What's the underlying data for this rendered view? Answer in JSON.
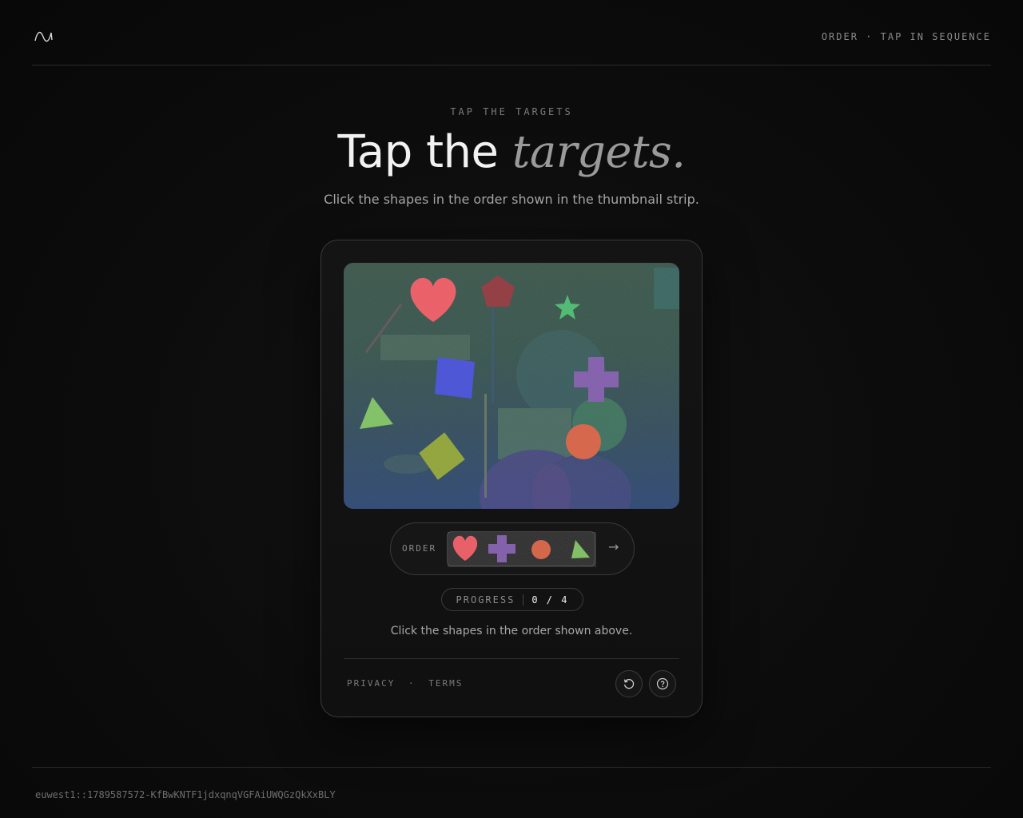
{
  "header": {
    "logo_icon": "wave-logo-icon",
    "nav_text": "ORDER · TAP IN SEQUENCE"
  },
  "hero": {
    "eyebrow": "TAP THE TARGETS",
    "title_plain": "Tap the",
    "title_italic": "targets.",
    "subtitle": "Click the shapes in the order shown in the thumbnail strip."
  },
  "challenge": {
    "canvas_shapes": [
      "heart",
      "pentagon",
      "star",
      "square",
      "cross",
      "triangle",
      "diamond",
      "circle"
    ],
    "order_label": "ORDER",
    "order_sequence": [
      "heart",
      "cross",
      "circle",
      "triangle"
    ],
    "order_arrow": "→",
    "progress_label": "PROGRESS",
    "progress_value": "0 / 4",
    "progress_done": 0,
    "progress_total": 4,
    "instruction": "Click the shapes in the order shown above.",
    "legal_privacy": "PRIVACY",
    "legal_sep": "·",
    "legal_terms": "TERMS",
    "reload_icon": "reload-icon",
    "help_icon": "help-icon"
  },
  "colors": {
    "heart": "#f0505a",
    "pentagon": "#8a2a30",
    "star": "#3fb866",
    "square": "#3a44d8",
    "cross": "#7a52a8",
    "triangle": "#78c058",
    "diamond": "#8aa028",
    "circle": "#d85838"
  },
  "footer": {
    "session_id": "euwest1::1789587572-KfBwKNTF1jdxqnqVGFAiUWQGzQkXxBLY"
  }
}
